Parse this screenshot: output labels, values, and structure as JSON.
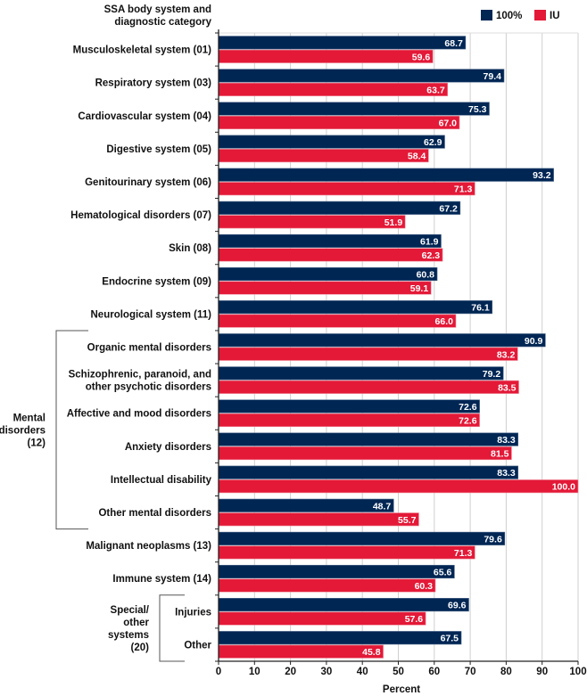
{
  "chart_data": {
    "type": "bar",
    "orientation": "horizontal",
    "title": "",
    "category_axis_title": [
      "SSA body system and",
      "diagnostic category"
    ],
    "xlabel": "Percent",
    "ylabel": "SSA body system and diagnostic category",
    "xlim": [
      0,
      100
    ],
    "xticks": [
      "0",
      "10",
      "20",
      "30",
      "40",
      "50",
      "60",
      "70",
      "80",
      "90",
      "100"
    ],
    "grid": "vertical",
    "legend_position": "top-right",
    "categories": [
      [
        "Musculoskeletal system (01)"
      ],
      [
        "Respiratory system (03)"
      ],
      [
        "Cardiovascular system (04)"
      ],
      [
        "Digestive system (05)"
      ],
      [
        "Genitourinary system (06)"
      ],
      [
        "Hematological disorders (07)"
      ],
      [
        "Skin (08)"
      ],
      [
        "Endocrine system (09)"
      ],
      [
        "Neurological system (11)"
      ],
      [
        "Organic mental disorders"
      ],
      [
        "Schizophrenic, paranoid, and",
        "other psychotic disorders"
      ],
      [
        "Affective and mood disorders"
      ],
      [
        "Anxiety disorders"
      ],
      [
        "Intellectual disability"
      ],
      [
        "Other mental disorders"
      ],
      [
        "Malignant neoplasms (13)"
      ],
      [
        "Immune system (14)"
      ],
      [
        "Injuries"
      ],
      [
        "Other"
      ]
    ],
    "groups": [
      {
        "label": [
          "Mental",
          "disorders",
          "(12)"
        ],
        "first": 9,
        "last": 14
      },
      {
        "label": [
          "Special/",
          "other",
          "systems",
          "(20)"
        ],
        "first": 17,
        "last": 18
      }
    ],
    "series": [
      {
        "name": "100%",
        "color": "#002654",
        "values": [
          68.7,
          79.4,
          75.3,
          62.9,
          93.2,
          67.2,
          61.9,
          60.8,
          76.1,
          90.9,
          79.2,
          72.6,
          83.3,
          83.3,
          48.7,
          79.6,
          65.6,
          69.6,
          67.5
        ],
        "labels": [
          "68.7",
          "79.4",
          "75.3",
          "62.9",
          "93.2",
          "67.2",
          "61.9",
          "60.8",
          "76.1",
          "90.9",
          "79.2",
          "72.6",
          "83.3",
          "83.3",
          "48.7",
          "79.6",
          "65.6",
          "69.6",
          "67.5"
        ]
      },
      {
        "name": "IU",
        "color": "#E31937",
        "values": [
          59.6,
          63.7,
          67.0,
          58.4,
          71.3,
          51.9,
          62.3,
          59.1,
          66.0,
          83.2,
          83.5,
          72.6,
          81.5,
          100.0,
          55.7,
          71.3,
          60.3,
          57.6,
          45.8
        ],
        "labels": [
          "59.6",
          "63.7",
          "67.0",
          "58.4",
          "71.3",
          "51.9",
          "62.3",
          "59.1",
          "66.0",
          "83.2",
          "83.5",
          "72.6",
          "81.5",
          "100.0",
          "55.7",
          "71.3",
          "60.3",
          "57.6",
          "45.8"
        ]
      }
    ]
  }
}
